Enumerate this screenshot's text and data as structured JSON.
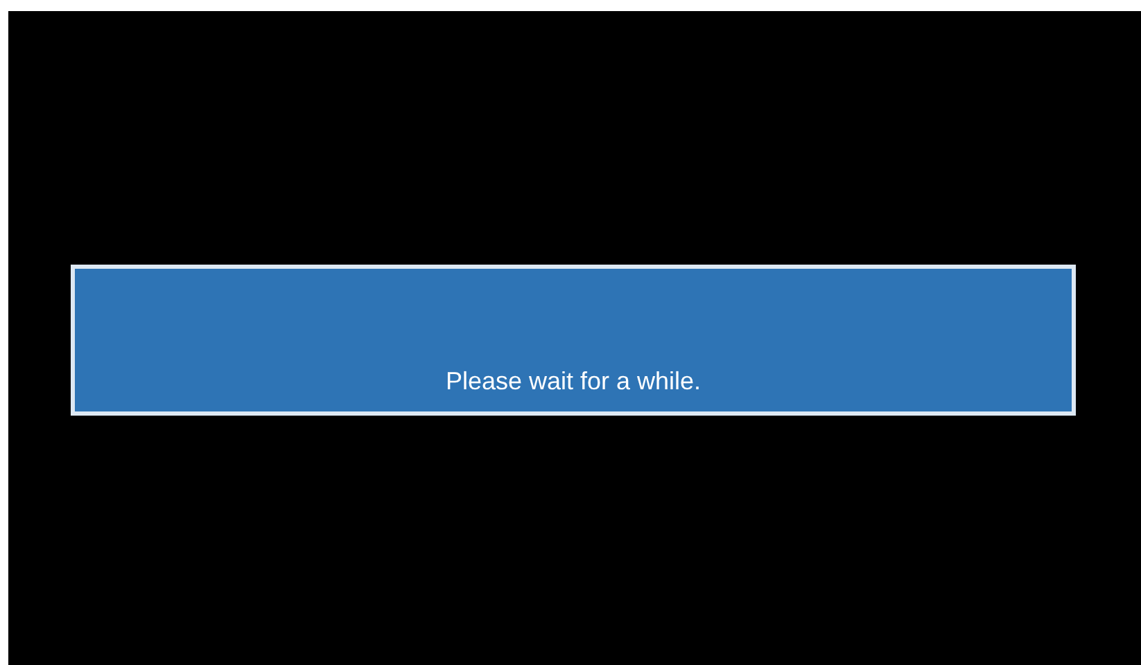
{
  "dialog": {
    "message": "Please wait for a while."
  }
}
